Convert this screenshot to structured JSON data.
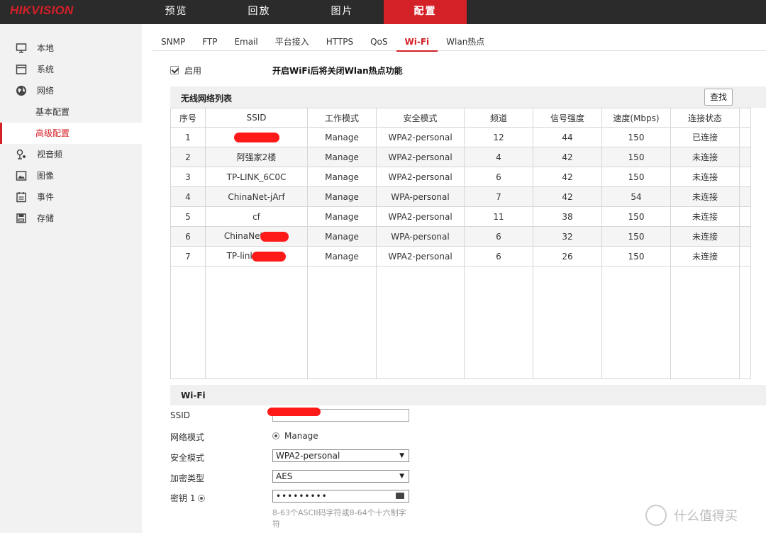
{
  "brand": {
    "logo_text": "HIKVISION",
    "accent": "#d42027"
  },
  "topnav": [
    {
      "label": "预览",
      "active": false
    },
    {
      "label": "回放",
      "active": false
    },
    {
      "label": "图片",
      "active": false
    },
    {
      "label": "配置",
      "active": true
    }
  ],
  "sidebar": {
    "items": [
      {
        "label": "本地",
        "icon": "monitor-icon"
      },
      {
        "label": "系统",
        "icon": "system-icon"
      },
      {
        "label": "网络",
        "icon": "globe-icon"
      },
      {
        "label": "视音频",
        "icon": "mic-icon"
      },
      {
        "label": "图像",
        "icon": "image-icon"
      },
      {
        "label": "事件",
        "icon": "calendar-icon"
      },
      {
        "label": "存储",
        "icon": "disk-icon"
      }
    ],
    "network_sub": [
      {
        "label": "基本配置",
        "active": false
      },
      {
        "label": "高级配置",
        "active": true
      }
    ]
  },
  "tabs": [
    {
      "label": "SNMP",
      "active": false
    },
    {
      "label": "FTP",
      "active": false
    },
    {
      "label": "Email",
      "active": false
    },
    {
      "label": "平台接入",
      "active": false
    },
    {
      "label": "HTTPS",
      "active": false
    },
    {
      "label": "QoS",
      "active": false
    },
    {
      "label": "Wi-Fi",
      "active": true
    },
    {
      "label": "Wlan热点",
      "active": false
    }
  ],
  "enable": {
    "label": "启用",
    "checked": true,
    "note": "开启WiFi后将关闭Wlan热点功能"
  },
  "wireless_list": {
    "title": "无线网络列表",
    "search_label": "查找",
    "columns": [
      "序号",
      "SSID",
      "工作模式",
      "安全模式",
      "频道",
      "信号强度",
      "速度(Mbps)",
      "连接状态"
    ],
    "rows": [
      [
        "1",
        "",
        "Manage",
        "WPA2-personal",
        "12",
        "44",
        "150",
        "已连接"
      ],
      [
        "2",
        "阿强家2楼",
        "Manage",
        "WPA2-personal",
        "4",
        "42",
        "150",
        "未连接"
      ],
      [
        "3",
        "TP-LINK_6C0C",
        "Manage",
        "WPA2-personal",
        "6",
        "42",
        "150",
        "未连接"
      ],
      [
        "4",
        "ChinaNet-jArf",
        "Manage",
        "WPA-personal",
        "7",
        "42",
        "54",
        "未连接"
      ],
      [
        "5",
        "cf",
        "Manage",
        "WPA2-personal",
        "11",
        "38",
        "150",
        "未连接"
      ],
      [
        "6",
        "ChinaNet",
        "Manage",
        "WPA-personal",
        "6",
        "32",
        "150",
        "未连接"
      ],
      [
        "7",
        "TP-link",
        "Manage",
        "WPA2-personal",
        "6",
        "26",
        "150",
        "未连接"
      ]
    ]
  },
  "wifi_form": {
    "section_title": "Wi-Fi",
    "ssid_label": "SSID",
    "network_mode_label": "网络模式",
    "network_mode_value": "Manage",
    "security_mode_label": "安全模式",
    "security_mode_value": "WPA2-personal",
    "encryption_label": "加密类型",
    "encryption_value": "AES",
    "key_label": "密钥 1",
    "key_value": "•••••••••",
    "hint": "8-63个ASCII码字符或8-64个十六制字符"
  },
  "watermark": {
    "text": "什么值得买"
  }
}
